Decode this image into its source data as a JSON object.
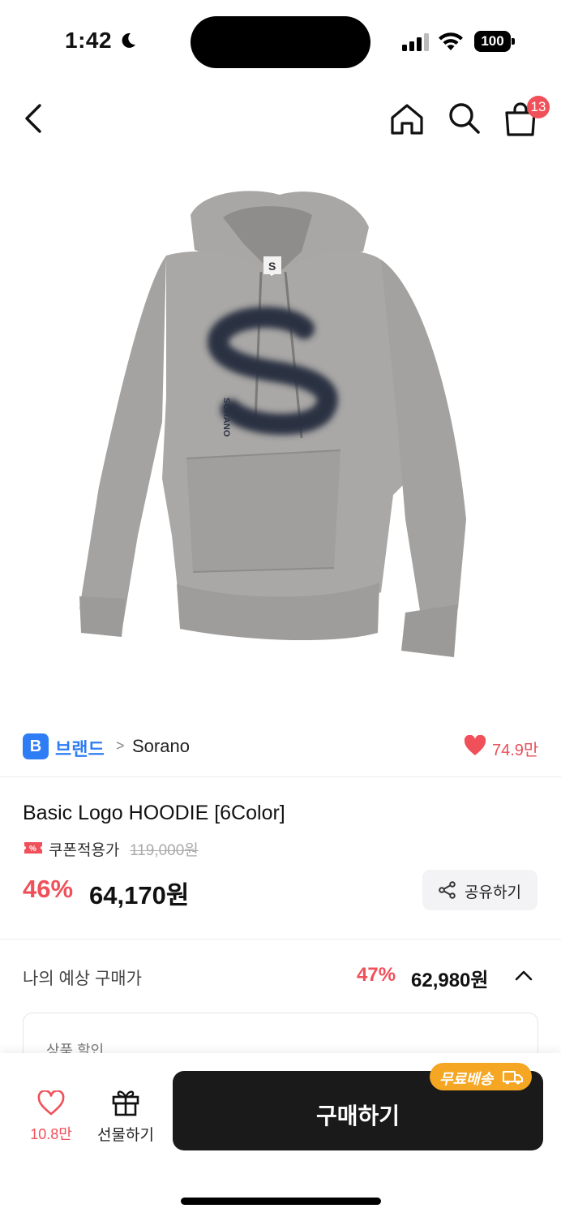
{
  "status_bar": {
    "time": "1:42",
    "battery": "100"
  },
  "nav": {
    "cart_count": "13"
  },
  "brand": {
    "badge": "B",
    "label": "브랜드",
    "chevron": ">",
    "name": "Sorano",
    "likes": "74.9만"
  },
  "product": {
    "title": "Basic Logo HOODIE [6Color]",
    "coupon_label": "쿠폰적용가",
    "original_price": "119,000원",
    "discount": "46%",
    "price": "64,170원",
    "share_label": "공유하기",
    "hoodie_tag": "S",
    "logo_text": "SORANO"
  },
  "estimate": {
    "label": "나의 예상 구매가",
    "discount": "47%",
    "price": "62,980원"
  },
  "discount_box": {
    "label": "상품 할인"
  },
  "bottom_bar": {
    "wish_count": "10.8만",
    "gift_label": "선물하기",
    "buy_label": "구매하기",
    "free_shipping": "무료배송"
  },
  "colors": {
    "accent_red": "#f0505a",
    "brand_blue": "#2f7df5",
    "buy_black": "#1a1a1a",
    "shipping_orange": "#f5a623"
  }
}
